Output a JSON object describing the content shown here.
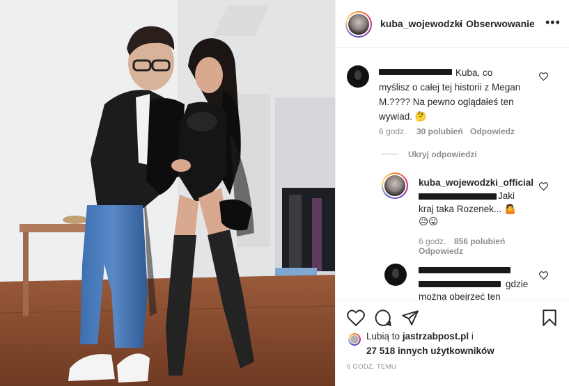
{
  "post": {
    "author": "kuba_wojewodzki",
    "separator": "•",
    "follow_status": "Obserwowanie",
    "more": "•••"
  },
  "comments": [
    {
      "text_lines": [
        "Kuba, co",
        "myślisz o całej tej historii z Megan",
        "M.???? Na pewno oglądałeś ten",
        "wywiad."
      ],
      "emoji": "🤔",
      "time": "6 godz.",
      "likes": "30 polubień",
      "reply": "Odpowiedz"
    }
  ],
  "hide_replies": "Ukryj odpowiedzi",
  "replies": [
    {
      "author": "kuba_wojewodzki_official",
      "text_line1": "Jaki",
      "text_line2": "kraj taka Rozenek...",
      "emoji1": "🤷",
      "emoji2": "😥😛",
      "time": "6 godz.",
      "likes": "856 polubień",
      "reply": "Odpowiedz"
    },
    {
      "text_tail1": "gdzie",
      "text_tail2": "można obejrzeć ten"
    }
  ],
  "likes_block": {
    "prefix": "Lubią to",
    "account": "jastrzabpost.pl",
    "and": "i",
    "count": "27 518 innych użytkowników"
  },
  "timestamp": "6 GODZ. TEMU",
  "icons": [
    "heart-icon",
    "comment-icon",
    "share-icon",
    "bookmark-icon",
    "more-icon"
  ]
}
